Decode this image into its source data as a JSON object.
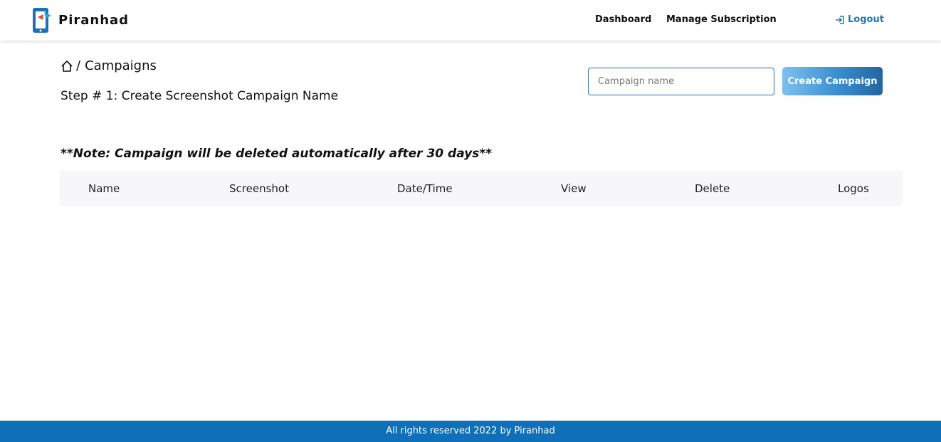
{
  "brand": {
    "name": "Piranhad",
    "logo_icon": "phone-app-icon"
  },
  "nav": {
    "dashboard": "Dashboard",
    "manage_subscription": "Manage Subscription",
    "logout": "Logout",
    "logout_icon": "logout-icon"
  },
  "breadcrumb": {
    "home_icon": "home-icon",
    "separator": "/",
    "current": "Campaigns"
  },
  "page": {
    "step_title": "Step # 1: Create Screenshot Campaign Name",
    "note": "**Note: Campaign will be deleted automatically after 30 days**"
  },
  "form": {
    "campaign_input_placeholder": "Campaign name",
    "campaign_input_value": "",
    "create_button": "Create Campaign"
  },
  "table": {
    "columns": [
      "Name",
      "Screenshot",
      "Date/Time",
      "View",
      "Delete",
      "Logos"
    ],
    "rows": []
  },
  "footer": {
    "text": "All rights reserved 2022 by Piranhad"
  },
  "colors": {
    "accent": "#1f78b4",
    "footer_bg": "#0f6fb7",
    "header_row_bg": "#f7f6f8"
  }
}
